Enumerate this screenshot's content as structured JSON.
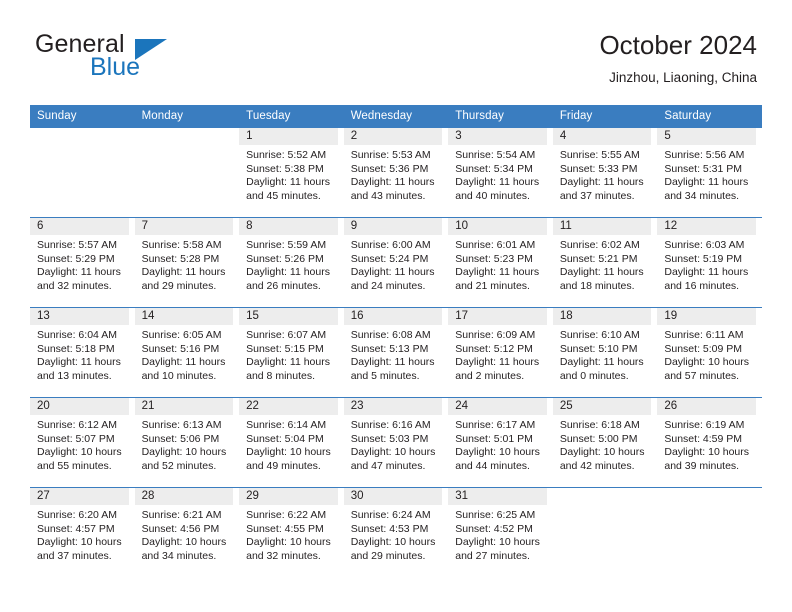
{
  "brand": {
    "word1": "General",
    "word2": "Blue",
    "logo_icon": "triangle-logo-icon",
    "accent_color": "#1b75bc"
  },
  "header": {
    "title": "October 2024",
    "location": "Jinzhou, Liaoning, China"
  },
  "theme": {
    "header_row_bg": "#3a7dc0",
    "daynum_band_bg": "#ededed",
    "separator": "#3a7dc0",
    "text": "#231f20"
  },
  "weekdays": [
    "Sunday",
    "Monday",
    "Tuesday",
    "Wednesday",
    "Thursday",
    "Friday",
    "Saturday"
  ],
  "weeks": [
    [
      {
        "blank": true
      },
      {
        "blank": true
      },
      {
        "day": "1",
        "sunrise": "Sunrise: 5:52 AM",
        "sunset": "Sunset: 5:38 PM",
        "daylight1": "Daylight: 11 hours",
        "daylight2": "and 45 minutes."
      },
      {
        "day": "2",
        "sunrise": "Sunrise: 5:53 AM",
        "sunset": "Sunset: 5:36 PM",
        "daylight1": "Daylight: 11 hours",
        "daylight2": "and 43 minutes."
      },
      {
        "day": "3",
        "sunrise": "Sunrise: 5:54 AM",
        "sunset": "Sunset: 5:34 PM",
        "daylight1": "Daylight: 11 hours",
        "daylight2": "and 40 minutes."
      },
      {
        "day": "4",
        "sunrise": "Sunrise: 5:55 AM",
        "sunset": "Sunset: 5:33 PM",
        "daylight1": "Daylight: 11 hours",
        "daylight2": "and 37 minutes."
      },
      {
        "day": "5",
        "sunrise": "Sunrise: 5:56 AM",
        "sunset": "Sunset: 5:31 PM",
        "daylight1": "Daylight: 11 hours",
        "daylight2": "and 34 minutes."
      }
    ],
    [
      {
        "day": "6",
        "sunrise": "Sunrise: 5:57 AM",
        "sunset": "Sunset: 5:29 PM",
        "daylight1": "Daylight: 11 hours",
        "daylight2": "and 32 minutes."
      },
      {
        "day": "7",
        "sunrise": "Sunrise: 5:58 AM",
        "sunset": "Sunset: 5:28 PM",
        "daylight1": "Daylight: 11 hours",
        "daylight2": "and 29 minutes."
      },
      {
        "day": "8",
        "sunrise": "Sunrise: 5:59 AM",
        "sunset": "Sunset: 5:26 PM",
        "daylight1": "Daylight: 11 hours",
        "daylight2": "and 26 minutes."
      },
      {
        "day": "9",
        "sunrise": "Sunrise: 6:00 AM",
        "sunset": "Sunset: 5:24 PM",
        "daylight1": "Daylight: 11 hours",
        "daylight2": "and 24 minutes."
      },
      {
        "day": "10",
        "sunrise": "Sunrise: 6:01 AM",
        "sunset": "Sunset: 5:23 PM",
        "daylight1": "Daylight: 11 hours",
        "daylight2": "and 21 minutes."
      },
      {
        "day": "11",
        "sunrise": "Sunrise: 6:02 AM",
        "sunset": "Sunset: 5:21 PM",
        "daylight1": "Daylight: 11 hours",
        "daylight2": "and 18 minutes."
      },
      {
        "day": "12",
        "sunrise": "Sunrise: 6:03 AM",
        "sunset": "Sunset: 5:19 PM",
        "daylight1": "Daylight: 11 hours",
        "daylight2": "and 16 minutes."
      }
    ],
    [
      {
        "day": "13",
        "sunrise": "Sunrise: 6:04 AM",
        "sunset": "Sunset: 5:18 PM",
        "daylight1": "Daylight: 11 hours",
        "daylight2": "and 13 minutes."
      },
      {
        "day": "14",
        "sunrise": "Sunrise: 6:05 AM",
        "sunset": "Sunset: 5:16 PM",
        "daylight1": "Daylight: 11 hours",
        "daylight2": "and 10 minutes."
      },
      {
        "day": "15",
        "sunrise": "Sunrise: 6:07 AM",
        "sunset": "Sunset: 5:15 PM",
        "daylight1": "Daylight: 11 hours",
        "daylight2": "and 8 minutes."
      },
      {
        "day": "16",
        "sunrise": "Sunrise: 6:08 AM",
        "sunset": "Sunset: 5:13 PM",
        "daylight1": "Daylight: 11 hours",
        "daylight2": "and 5 minutes."
      },
      {
        "day": "17",
        "sunrise": "Sunrise: 6:09 AM",
        "sunset": "Sunset: 5:12 PM",
        "daylight1": "Daylight: 11 hours",
        "daylight2": "and 2 minutes."
      },
      {
        "day": "18",
        "sunrise": "Sunrise: 6:10 AM",
        "sunset": "Sunset: 5:10 PM",
        "daylight1": "Daylight: 11 hours",
        "daylight2": "and 0 minutes."
      },
      {
        "day": "19",
        "sunrise": "Sunrise: 6:11 AM",
        "sunset": "Sunset: 5:09 PM",
        "daylight1": "Daylight: 10 hours",
        "daylight2": "and 57 minutes."
      }
    ],
    [
      {
        "day": "20",
        "sunrise": "Sunrise: 6:12 AM",
        "sunset": "Sunset: 5:07 PM",
        "daylight1": "Daylight: 10 hours",
        "daylight2": "and 55 minutes."
      },
      {
        "day": "21",
        "sunrise": "Sunrise: 6:13 AM",
        "sunset": "Sunset: 5:06 PM",
        "daylight1": "Daylight: 10 hours",
        "daylight2": "and 52 minutes."
      },
      {
        "day": "22",
        "sunrise": "Sunrise: 6:14 AM",
        "sunset": "Sunset: 5:04 PM",
        "daylight1": "Daylight: 10 hours",
        "daylight2": "and 49 minutes."
      },
      {
        "day": "23",
        "sunrise": "Sunrise: 6:16 AM",
        "sunset": "Sunset: 5:03 PM",
        "daylight1": "Daylight: 10 hours",
        "daylight2": "and 47 minutes."
      },
      {
        "day": "24",
        "sunrise": "Sunrise: 6:17 AM",
        "sunset": "Sunset: 5:01 PM",
        "daylight1": "Daylight: 10 hours",
        "daylight2": "and 44 minutes."
      },
      {
        "day": "25",
        "sunrise": "Sunrise: 6:18 AM",
        "sunset": "Sunset: 5:00 PM",
        "daylight1": "Daylight: 10 hours",
        "daylight2": "and 42 minutes."
      },
      {
        "day": "26",
        "sunrise": "Sunrise: 6:19 AM",
        "sunset": "Sunset: 4:59 PM",
        "daylight1": "Daylight: 10 hours",
        "daylight2": "and 39 minutes."
      }
    ],
    [
      {
        "day": "27",
        "sunrise": "Sunrise: 6:20 AM",
        "sunset": "Sunset: 4:57 PM",
        "daylight1": "Daylight: 10 hours",
        "daylight2": "and 37 minutes."
      },
      {
        "day": "28",
        "sunrise": "Sunrise: 6:21 AM",
        "sunset": "Sunset: 4:56 PM",
        "daylight1": "Daylight: 10 hours",
        "daylight2": "and 34 minutes."
      },
      {
        "day": "29",
        "sunrise": "Sunrise: 6:22 AM",
        "sunset": "Sunset: 4:55 PM",
        "daylight1": "Daylight: 10 hours",
        "daylight2": "and 32 minutes."
      },
      {
        "day": "30",
        "sunrise": "Sunrise: 6:24 AM",
        "sunset": "Sunset: 4:53 PM",
        "daylight1": "Daylight: 10 hours",
        "daylight2": "and 29 minutes."
      },
      {
        "day": "31",
        "sunrise": "Sunrise: 6:25 AM",
        "sunset": "Sunset: 4:52 PM",
        "daylight1": "Daylight: 10 hours",
        "daylight2": "and 27 minutes."
      },
      {
        "blank": true
      },
      {
        "blank": true
      }
    ]
  ]
}
